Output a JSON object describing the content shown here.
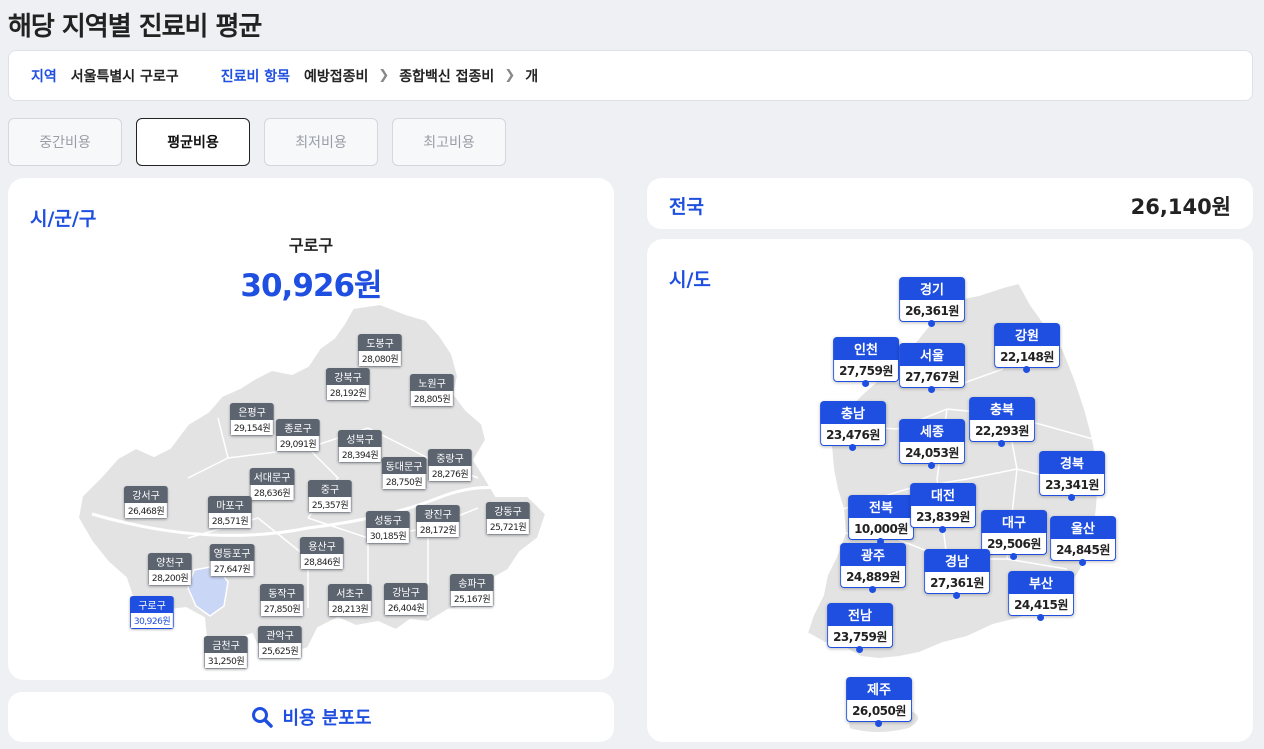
{
  "page": {
    "title": "해당 지역별 진료비 평균"
  },
  "filter": {
    "region_label": "지역",
    "region_value": "서울특별시 구로구",
    "item_label": "진료비 항목",
    "crumbs": [
      "예방접종비",
      "종합백신 접종비",
      "개"
    ]
  },
  "tabs": [
    {
      "label": "중간비용",
      "active": false
    },
    {
      "label": "평균비용",
      "active": true
    },
    {
      "label": "최저비용",
      "active": false
    },
    {
      "label": "최고비용",
      "active": false
    }
  ],
  "district_card": {
    "title": "시/군/구",
    "selected_name": "구로구",
    "selected_price": "30,926원"
  },
  "seoul_districts": [
    {
      "name": "도봉구",
      "price": "28,080원"
    },
    {
      "name": "강북구",
      "price": "28,192원"
    },
    {
      "name": "노원구",
      "price": "28,805원"
    },
    {
      "name": "은평구",
      "price": "29,154원"
    },
    {
      "name": "종로구",
      "price": "29,091원"
    },
    {
      "name": "성북구",
      "price": "28,394원"
    },
    {
      "name": "중랑구",
      "price": "28,276원"
    },
    {
      "name": "동대문구",
      "price": "28,750원"
    },
    {
      "name": "서대문구",
      "price": "28,636원"
    },
    {
      "name": "강서구",
      "price": "26,468원"
    },
    {
      "name": "마포구",
      "price": "28,571원"
    },
    {
      "name": "중구",
      "price": "25,357원"
    },
    {
      "name": "성동구",
      "price": "30,185원"
    },
    {
      "name": "광진구",
      "price": "28,172원"
    },
    {
      "name": "강동구",
      "price": "25,721원"
    },
    {
      "name": "양천구",
      "price": "28,200원"
    },
    {
      "name": "영등포구",
      "price": "27,647원"
    },
    {
      "name": "용산구",
      "price": "28,846원"
    },
    {
      "name": "구로구",
      "price": "30,926원",
      "selected": true
    },
    {
      "name": "동작구",
      "price": "27,850원"
    },
    {
      "name": "서초구",
      "price": "28,213원"
    },
    {
      "name": "강남구",
      "price": "26,404원"
    },
    {
      "name": "송파구",
      "price": "25,167원"
    },
    {
      "name": "금천구",
      "price": "31,250원"
    },
    {
      "name": "관악구",
      "price": "25,625원"
    }
  ],
  "search_button": {
    "label": "비용 분포도",
    "icon": "search-icon"
  },
  "nation": {
    "label": "전국",
    "price": "26,140원"
  },
  "province_card": {
    "title": "시/도"
  },
  "provinces": [
    {
      "name": "경기",
      "price": "26,361원"
    },
    {
      "name": "인천",
      "price": "27,759원"
    },
    {
      "name": "서울",
      "price": "27,767원"
    },
    {
      "name": "강원",
      "price": "22,148원"
    },
    {
      "name": "충남",
      "price": "23,476원"
    },
    {
      "name": "세종",
      "price": "24,053원"
    },
    {
      "name": "충북",
      "price": "22,293원"
    },
    {
      "name": "경북",
      "price": "23,341원"
    },
    {
      "name": "전북",
      "price": "10,000원"
    },
    {
      "name": "대전",
      "price": "23,839원"
    },
    {
      "name": "대구",
      "price": "29,506원"
    },
    {
      "name": "울산",
      "price": "24,845원"
    },
    {
      "name": "광주",
      "price": "24,889원"
    },
    {
      "name": "경남",
      "price": "27,361원"
    },
    {
      "name": "부산",
      "price": "24,415원"
    },
    {
      "name": "전남",
      "price": "23,759원"
    },
    {
      "name": "제주",
      "price": "26,050원"
    }
  ],
  "colors": {
    "accent": "#1f4fe0",
    "label_bg": "#5c6470",
    "map_fill": "#e3e3e3",
    "selected_fill": "#c9d6f5"
  }
}
